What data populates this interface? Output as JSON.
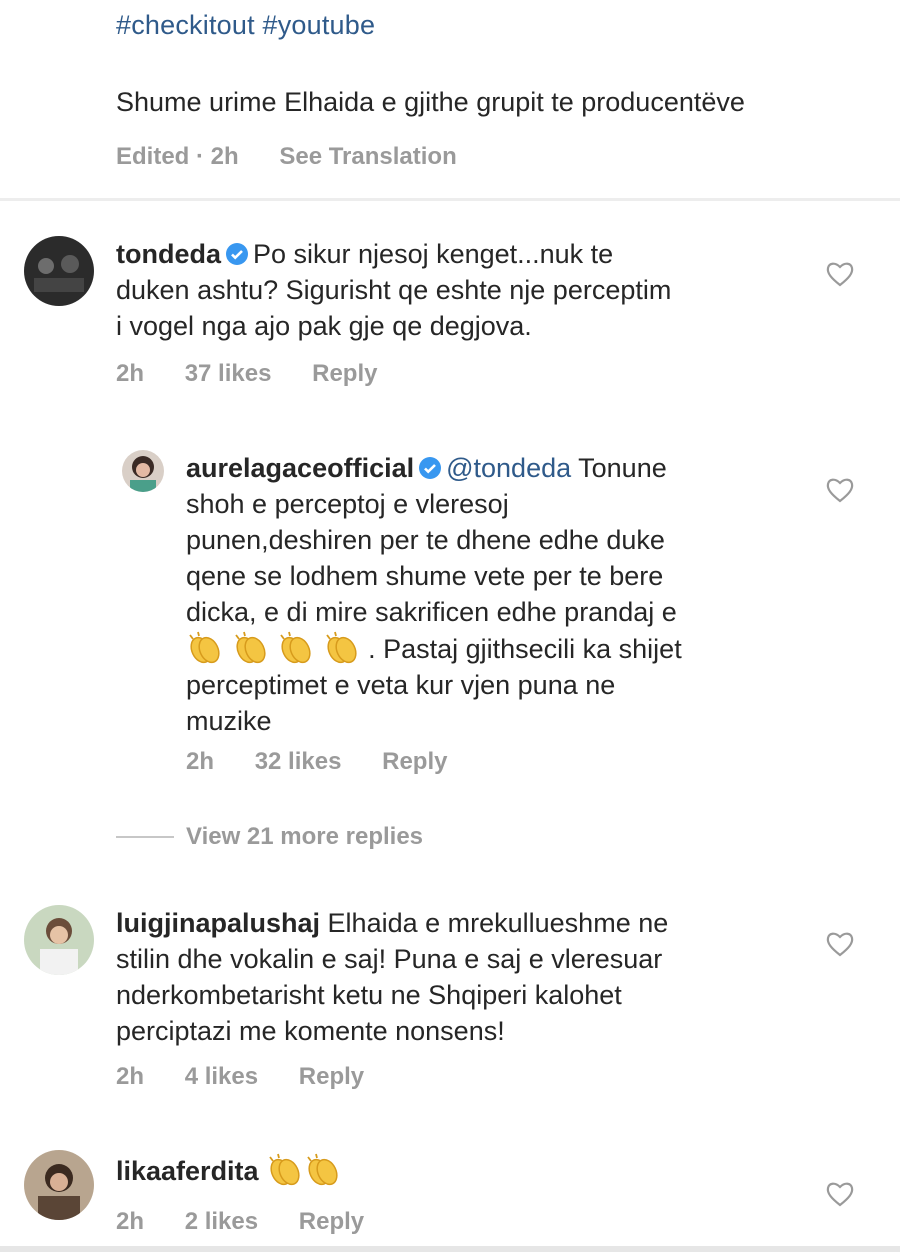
{
  "caption": {
    "hashtags": "#checkitout #youtube",
    "text": "Shume urime Elhaida e gjithe grupit te producentëve",
    "edited": "Edited · 2h",
    "see_translation": "See Translation"
  },
  "comments": [
    {
      "username": "tondeda",
      "line1": "Po sikur njesoj kenget...nuk te",
      "line2": "duken ashtu? Sigurisht qe eshte nje perceptim",
      "line3": "i vogel nga ajo pak gje qe degjova.",
      "time": "2h",
      "likes": "37 likes",
      "reply": "Reply"
    },
    {
      "username": "aurelagaceofficial",
      "mention": "@tondeda",
      "line1": "Tonune",
      "line2": "shoh e perceptoj  e vleresoj",
      "line3": "punen,deshiren per te dhene edhe duke",
      "line4": "qene se lodhem shume vete per te bere",
      "line5": "dicka, e di mire sakrificen edhe prandaj e",
      "line6": ". Pastaj gjithsecili ka shijet",
      "line7": "perceptimet e veta kur vjen puna ne",
      "line8": "muzike",
      "time": "2h",
      "likes": "32 likes",
      "reply": "Reply"
    },
    {
      "username": "luigjinapalushaj",
      "line1": "Elhaida e mrekullueshme ne",
      "line2": "stilin dhe vokalin e saj! Puna e saj e vleresuar",
      "line3": "nderkombetarisht ketu ne Shqiperi kalohet",
      "line4": "perciptazi me komente nonsens!",
      "time": "2h",
      "likes": "4 likes",
      "reply": "Reply"
    },
    {
      "username": "likaaferdita",
      "time": "2h",
      "likes": "2 likes",
      "reply": "Reply"
    }
  ],
  "view_more": "View 21 more replies",
  "colors": {
    "link": "#2f5a8a",
    "meta": "#9a9a9a",
    "verified": "#3897f0"
  },
  "icons": [
    "verified-icon",
    "heart-icon",
    "clapping-hands-icon"
  ]
}
